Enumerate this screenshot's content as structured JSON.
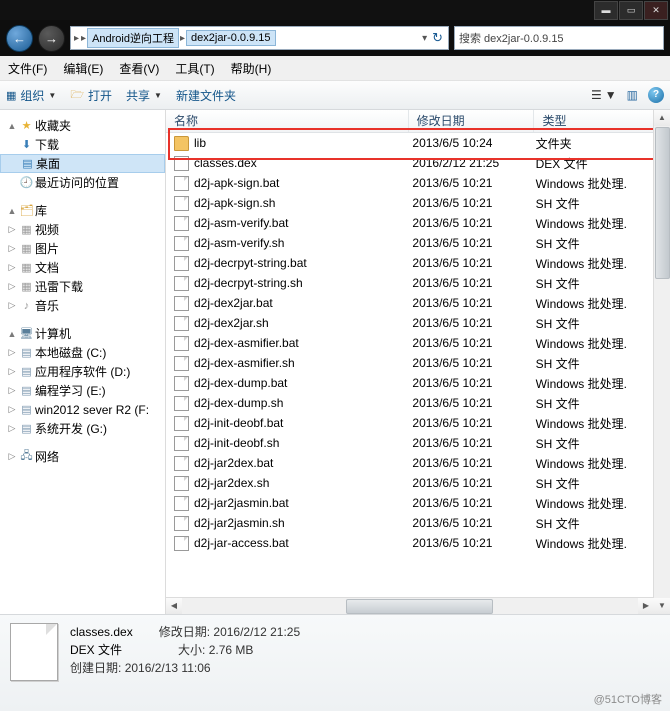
{
  "window": {
    "buttons": [
      {
        "name": "minimize",
        "glyph": "▬"
      },
      {
        "name": "maximize",
        "glyph": "▭"
      },
      {
        "name": "close",
        "glyph": "✕"
      }
    ]
  },
  "nav": {
    "back_glyph": "←",
    "forward_glyph": "→",
    "breadcrumb": [
      "Android逆向工程",
      "dex2jar-0.0.9.15"
    ],
    "breadcrumb_prefix_glyph": "▸",
    "dropdown_glyph": "▾",
    "refresh_glyph": "↻",
    "search_placeholder": "搜索 dex2jar-0.0.9.15",
    "search_icon": "search-icon"
  },
  "menubar": [
    "文件(F)",
    "编辑(E)",
    "查看(V)",
    "工具(T)",
    "帮助(H)"
  ],
  "commandbar": {
    "organize": "组织",
    "open": "打开",
    "share": "共享",
    "newfolder": "新建文件夹",
    "view_label": "",
    "preview_label": "",
    "help_label": "?"
  },
  "sidebar": {
    "favorites_title": "收藏夹",
    "favorites": [
      "下载",
      "桌面",
      "最近访问的位置"
    ],
    "library_title": "库",
    "library": [
      "视频",
      "图片",
      "文档",
      "迅雷下载",
      "音乐"
    ],
    "computer_title": "计算机",
    "computer": [
      "本地磁盘 (C:)",
      "应用程序软件 (D:)",
      "编程学习 (E:)",
      "win2012 sever  R2 (F:",
      "系统开发 (G:)"
    ],
    "network_title": "网络",
    "selected": "桌面"
  },
  "filelist": {
    "columns": [
      "名称",
      "修改日期",
      "类型"
    ],
    "rows": [
      {
        "name": "lib",
        "date": "2013/6/5 10:24",
        "type": "文件夹",
        "icon": "folder-icon"
      },
      {
        "name": "classes.dex",
        "date": "2016/2/12 21:25",
        "type": "DEX 文件",
        "icon": "dex-file-icon",
        "highlighted": true
      },
      {
        "name": "d2j-apk-sign.bat",
        "date": "2013/6/5 10:21",
        "type": "Windows 批处理.",
        "icon": "bat-file-icon"
      },
      {
        "name": "d2j-apk-sign.sh",
        "date": "2013/6/5 10:21",
        "type": "SH 文件",
        "icon": "sh-file-icon"
      },
      {
        "name": "d2j-asm-verify.bat",
        "date": "2013/6/5 10:21",
        "type": "Windows 批处理.",
        "icon": "bat-file-icon"
      },
      {
        "name": "d2j-asm-verify.sh",
        "date": "2013/6/5 10:21",
        "type": "SH 文件",
        "icon": "sh-file-icon"
      },
      {
        "name": "d2j-decrpyt-string.bat",
        "date": "2013/6/5 10:21",
        "type": "Windows 批处理.",
        "icon": "bat-file-icon"
      },
      {
        "name": "d2j-decrpyt-string.sh",
        "date": "2013/6/5 10:21",
        "type": "SH 文件",
        "icon": "sh-file-icon"
      },
      {
        "name": "d2j-dex2jar.bat",
        "date": "2013/6/5 10:21",
        "type": "Windows 批处理.",
        "icon": "bat-file-icon"
      },
      {
        "name": "d2j-dex2jar.sh",
        "date": "2013/6/5 10:21",
        "type": "SH 文件",
        "icon": "sh-file-icon"
      },
      {
        "name": "d2j-dex-asmifier.bat",
        "date": "2013/6/5 10:21",
        "type": "Windows 批处理.",
        "icon": "bat-file-icon"
      },
      {
        "name": "d2j-dex-asmifier.sh",
        "date": "2013/6/5 10:21",
        "type": "SH 文件",
        "icon": "sh-file-icon"
      },
      {
        "name": "d2j-dex-dump.bat",
        "date": "2013/6/5 10:21",
        "type": "Windows 批处理.",
        "icon": "bat-file-icon"
      },
      {
        "name": "d2j-dex-dump.sh",
        "date": "2013/6/5 10:21",
        "type": "SH 文件",
        "icon": "sh-file-icon"
      },
      {
        "name": "d2j-init-deobf.bat",
        "date": "2013/6/5 10:21",
        "type": "Windows 批处理.",
        "icon": "bat-file-icon"
      },
      {
        "name": "d2j-init-deobf.sh",
        "date": "2013/6/5 10:21",
        "type": "SH 文件",
        "icon": "sh-file-icon"
      },
      {
        "name": "d2j-jar2dex.bat",
        "date": "2013/6/5 10:21",
        "type": "Windows 批处理.",
        "icon": "bat-file-icon"
      },
      {
        "name": "d2j-jar2dex.sh",
        "date": "2013/6/5 10:21",
        "type": "SH 文件",
        "icon": "sh-file-icon"
      },
      {
        "name": "d2j-jar2jasmin.bat",
        "date": "2013/6/5 10:21",
        "type": "Windows 批处理.",
        "icon": "bat-file-icon"
      },
      {
        "name": "d2j-jar2jasmin.sh",
        "date": "2013/6/5 10:21",
        "type": "SH 文件",
        "icon": "sh-file-icon"
      },
      {
        "name": "d2j-jar-access.bat",
        "date": "2013/6/5 10:21",
        "type": "Windows 批处理.",
        "icon": "bat-file-icon"
      }
    ]
  },
  "details": {
    "filename": "classes.dex",
    "modified_label": "修改日期:",
    "modified_value": "2016/2/12 21:25",
    "type_value": "DEX 文件",
    "size_label": "大小:",
    "size_value": "2.76 MB",
    "created_label": "创建日期:",
    "created_value": "2016/2/13 11:06"
  },
  "watermark": "@51CTO博客",
  "colors": {
    "highlight_box": "#e8322a",
    "selection": "#cfe5f7",
    "link": "#14568a"
  }
}
